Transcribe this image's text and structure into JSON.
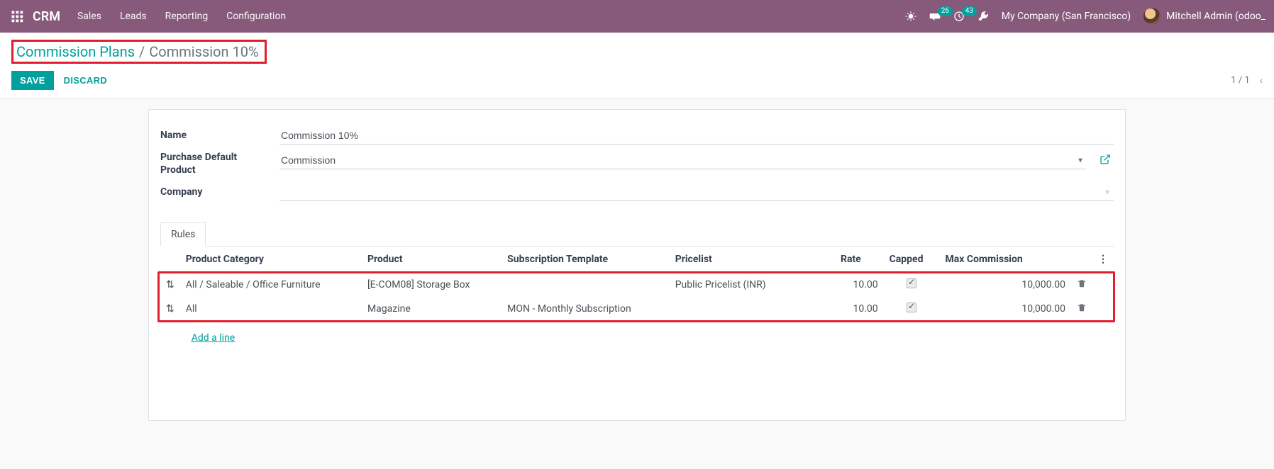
{
  "nav": {
    "brand": "CRM",
    "items": [
      "Sales",
      "Leads",
      "Reporting",
      "Configuration"
    ],
    "msg_badge": "26",
    "act_badge": "43",
    "company": "My Company (San Francisco)",
    "user": "Mitchell Admin (odoo_"
  },
  "breadcrumb": {
    "parent": "Commission Plans",
    "sep": "/",
    "current": "Commission 10%"
  },
  "buttons": {
    "save": "SAVE",
    "discard": "DISCARD"
  },
  "pager": {
    "text": "1 / 1"
  },
  "form": {
    "labels": {
      "name": "Name",
      "purchase_product": "Purchase Default Product",
      "company": "Company"
    },
    "values": {
      "name": "Commission 10%",
      "purchase_product": "Commission",
      "company": ""
    }
  },
  "tabs": {
    "rules": "Rules"
  },
  "table": {
    "headers": {
      "product_category": "Product Category",
      "product": "Product",
      "subscription_template": "Subscription Template",
      "pricelist": "Pricelist",
      "rate": "Rate",
      "capped": "Capped",
      "max_commission": "Max Commission"
    },
    "rows": [
      {
        "product_category": "All / Saleable / Office Furniture",
        "product": "[E-COM08] Storage Box",
        "subscription_template": "",
        "pricelist": "Public Pricelist (INR)",
        "rate": "10.00",
        "capped": true,
        "max_commission": "10,000.00"
      },
      {
        "product_category": "All",
        "product": "Magazine",
        "subscription_template": "MON - Monthly Subscription",
        "pricelist": "",
        "rate": "10.00",
        "capped": true,
        "max_commission": "10,000.00"
      }
    ],
    "add_line": "Add a line"
  }
}
